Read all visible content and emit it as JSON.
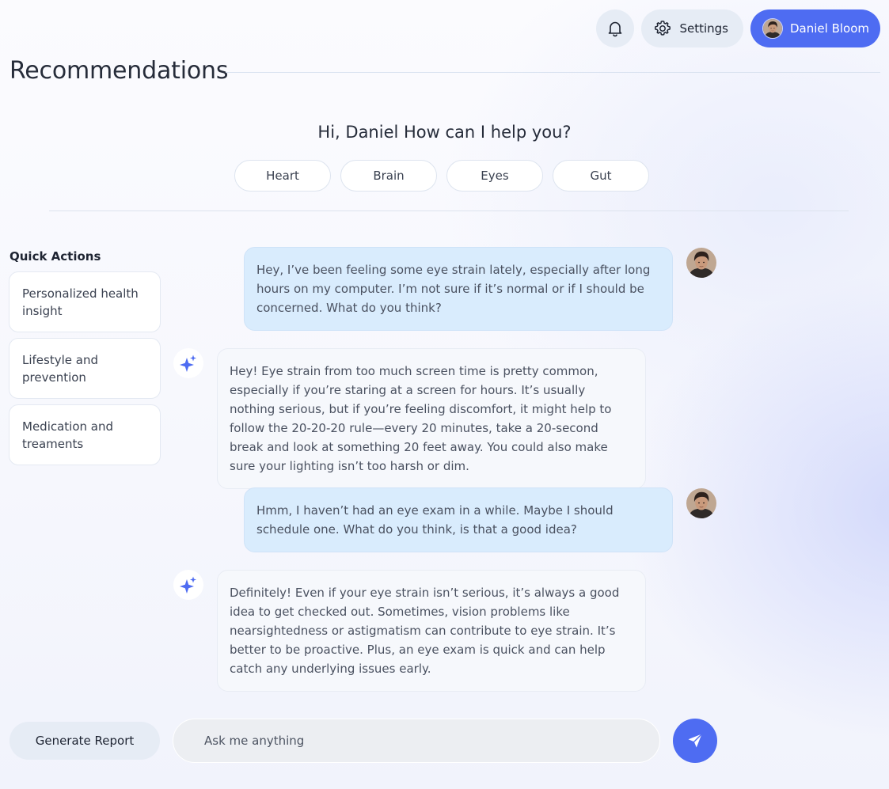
{
  "header": {
    "settings_label": "Settings",
    "user_name": "Daniel Bloom",
    "icons": {
      "notifications": "bell-icon",
      "settings": "gear-icon"
    }
  },
  "page": {
    "title": "Recommendations"
  },
  "greeting": {
    "text": "Hi, Daniel How can I help you?",
    "topics": [
      "Heart",
      "Brain",
      "Eyes",
      "Gut"
    ]
  },
  "quick_actions": {
    "heading": "Quick Actions",
    "items": [
      "Personalized health insight",
      "Lifestyle and prevention",
      "Medication and treaments"
    ]
  },
  "chat": {
    "messages": [
      {
        "role": "user",
        "text": "Hey, I’ve been feeling some eye strain lately, especially after long hours on my computer. I’m not sure if it’s normal or if I should be concerned. What do you think?"
      },
      {
        "role": "assistant",
        "text": "Hey! Eye strain from too much screen time is pretty common, especially if you’re staring at a screen for hours. It’s usually nothing serious, but if you’re feeling discomfort, it might help to follow the 20-20-20 rule—every 20 minutes, take a 20-second break and look at something 20 feet away. You could also make sure your lighting isn’t too harsh or dim."
      },
      {
        "role": "user",
        "text": "Hmm, I haven’t had an eye exam in a while. Maybe I should schedule one. What do you think, is that a good idea?"
      },
      {
        "role": "assistant",
        "text": "Definitely! Even if your eye strain isn’t serious, it’s always a good idea to get checked out. Sometimes, vision problems like nearsightedness or astigmatism can contribute to eye strain. It’s better to be proactive. Plus, an eye exam is quick and can help catch any underlying issues early."
      }
    ]
  },
  "composer": {
    "report_label": "Generate Report",
    "placeholder": "Ask me anything",
    "value": "",
    "send_icon": "send-icon"
  },
  "colors": {
    "accent": "#4e6cf2",
    "user_bubble": "#d9ecfd",
    "bot_bubble": "#f6f8fc",
    "pill_bg": "#e6ecf5"
  }
}
